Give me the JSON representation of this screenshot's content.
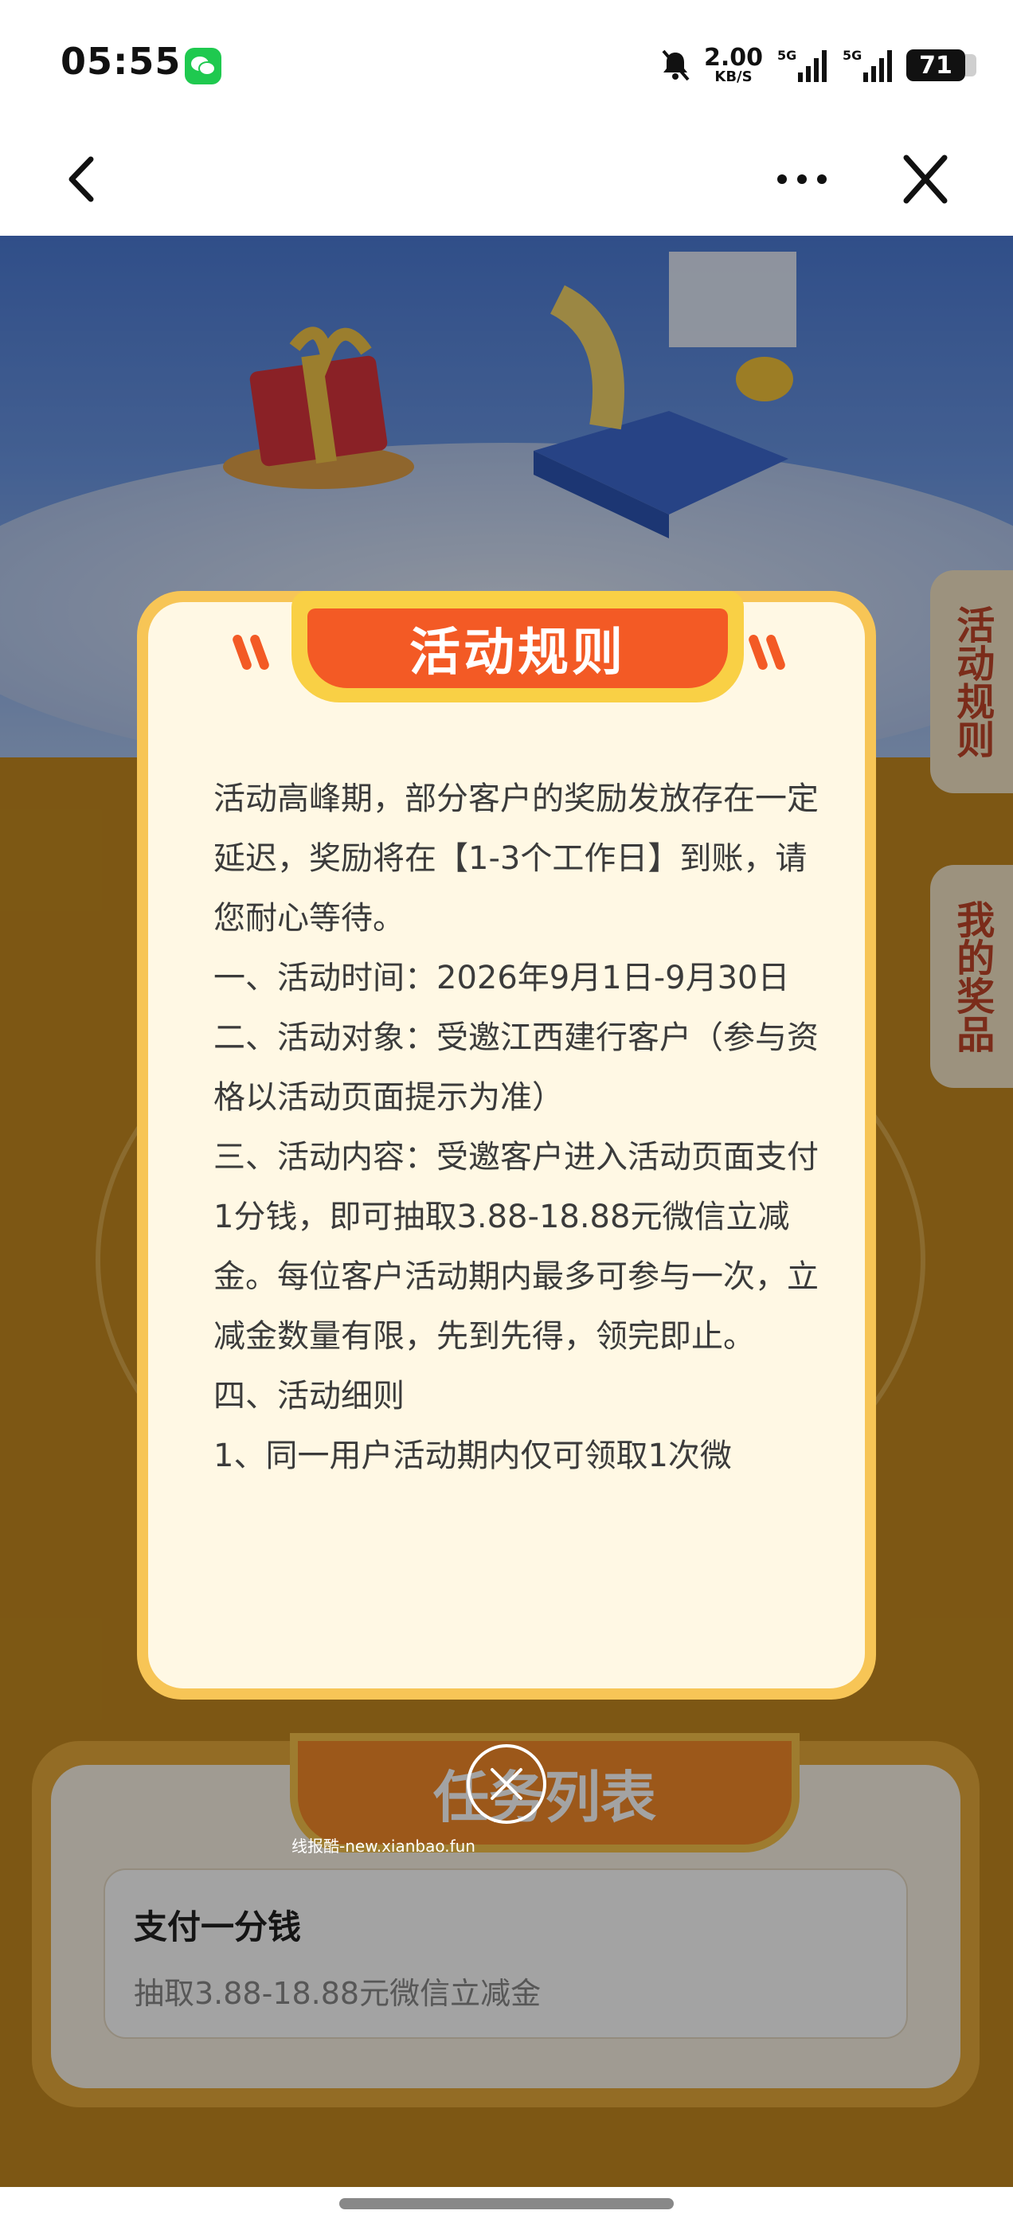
{
  "status_bar": {
    "time": "05:55",
    "net_speed": "2.00",
    "net_unit": "KB/S",
    "signal1_label": "5G",
    "signal2_label": "5G",
    "battery": "71"
  },
  "nav": {
    "back_icon": "chevron-left-icon",
    "more_icon": "more-dots-icon",
    "close_icon": "close-icon"
  },
  "side_tabs": {
    "rules": "活动规则",
    "prizes": "我的奖品"
  },
  "task_section": {
    "banner": "任务列表",
    "items": [
      {
        "title": "支付一分钱",
        "desc": "抽取3.88-18.88元微信立减金"
      }
    ]
  },
  "watermark": "线报酷-new.xianbao.fun",
  "modal": {
    "title": "活动规则",
    "paragraphs": [
      "活动高峰期，部分客户的奖励发放存在一定延迟，奖励将在【1-3个工作日】到账，请您耐心等待。",
      "一、活动时间：2026年9月1日-9月30日",
      "二、活动对象：受邀江西建行客户（参与资格以活动页面提示为准）",
      "三、活动内容：受邀客户进入活动页面支付1分钱，即可抽取3.88-18.88元微信立减金。每位客户活动期内最多可参与一次，立减金数量有限，先到先得，领完即止。",
      "四、活动细则",
      "1、同一用户活动期内仅可领取1次微"
    ]
  },
  "colors": {
    "accent_orange": "#f35a25",
    "modal_border": "#f7c556",
    "wechat_green": "#1fc94f"
  }
}
